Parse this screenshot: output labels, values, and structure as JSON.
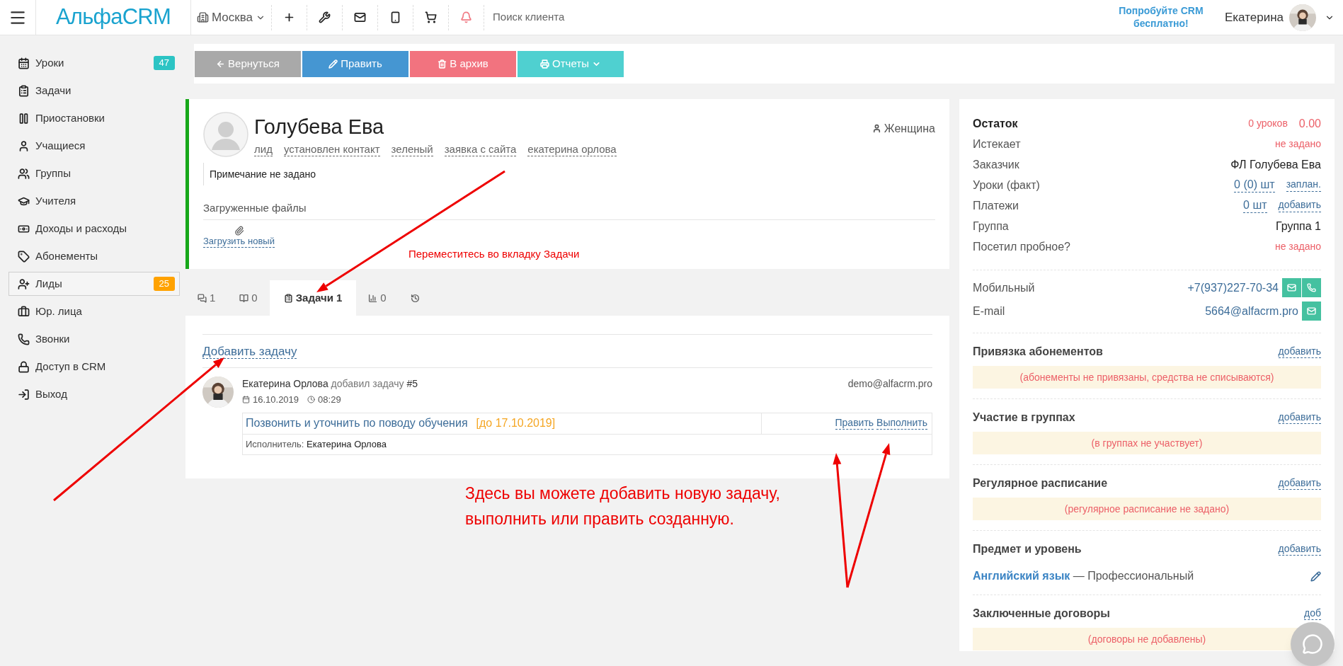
{
  "topbar": {
    "logo": "АльфаCRM",
    "city": "Москва",
    "search": {
      "placeholder": "Поиск клиента"
    },
    "promo": "Попробуйте CRM бесплатно!",
    "user": "Екатерина"
  },
  "sidebar": {
    "items": [
      {
        "label": "Уроки",
        "badge": "47",
        "color": "#2cc4c4",
        "selected": false
      },
      {
        "label": "Задачи",
        "selected": false
      },
      {
        "label": "Приостановки",
        "selected": false
      },
      {
        "label": "Учащиеся",
        "selected": false
      },
      {
        "label": "Группы",
        "selected": false
      },
      {
        "label": "Учителя",
        "selected": false
      },
      {
        "label": "Доходы и расходы",
        "selected": false
      },
      {
        "label": "Абонементы",
        "selected": false
      },
      {
        "label": "Лиды",
        "badge": "25",
        "color": "#ffa200",
        "selected": true
      },
      {
        "label": "Юр. лица",
        "selected": false
      },
      {
        "label": "Звонки",
        "selected": false
      },
      {
        "label": "Доступ в CRM",
        "selected": false
      },
      {
        "label": "Выход",
        "selected": false
      }
    ]
  },
  "actions": [
    {
      "kind": "back",
      "label": "Вернуться"
    },
    {
      "kind": "edit",
      "label": "Править"
    },
    {
      "kind": "archive",
      "label": "В архив"
    },
    {
      "kind": "reports",
      "label": "Отчеты"
    }
  ],
  "profile": {
    "name": "Голубева Ева",
    "gender": "Женщина",
    "tags": [
      "лид",
      "установлен контакт",
      "зеленый",
      "заявка с сайта",
      "екатерина орлова"
    ],
    "note": "Примечание не задано",
    "files_title": "Загруженные файлы",
    "upload": "Загрузить новый"
  },
  "tabs": [
    {
      "kind": "comments",
      "label": "1",
      "selected": false
    },
    {
      "kind": "book",
      "label": "0",
      "selected": false
    },
    {
      "kind": "tasks",
      "label": "Задачи 1",
      "selected": true
    },
    {
      "kind": "stats",
      "label": "0",
      "selected": false
    },
    {
      "kind": "history",
      "selected": false
    }
  ],
  "tasks": {
    "add": "Добавить задачу",
    "entries": [
      {
        "author": "Екатерина Орлова",
        "action": "добавил задачу",
        "number": "#5",
        "date": "16.10.2019",
        "time": "08:29",
        "email": "demo@alfacrm.pro",
        "title": "Позвонить и уточнить по поводу обучения",
        "deadline": "[до 17.10.2019]",
        "links": [
          "Править",
          "Выполнить"
        ],
        "executor_label": "Исполнитель:",
        "executor": "Екатерина Орлова"
      }
    ]
  },
  "annotations": [
    "Переместитесь во вкладку Задачи",
    "Здесь вы можете добавить новую задачу,\nвыполнить или править созданную."
  ],
  "summary": [
    {
      "label": "Остаток",
      "strong": true,
      "values": [
        {
          "kind": "red",
          "text": "0 уроков"
        },
        {
          "kind": "red_big",
          "text": "0.00"
        }
      ]
    },
    {
      "label": "Истекает",
      "strong": false,
      "values": [
        {
          "kind": "red",
          "text": "не задано"
        }
      ]
    },
    {
      "label": "Заказчик",
      "strong": false,
      "values": [
        {
          "kind": "plain",
          "text": "ФЛ Голубева Ева"
        }
      ]
    },
    {
      "label": "Уроки (факт)",
      "strong": false,
      "values": [
        {
          "kind": "link",
          "text": "0 (0) шт"
        },
        {
          "kind": "action",
          "text": "заплан."
        }
      ]
    },
    {
      "label": "Платежи",
      "strong": false,
      "values": [
        {
          "kind": "link",
          "text": "0 шт"
        },
        {
          "kind": "action",
          "text": "добавить"
        }
      ]
    },
    {
      "label": "Группа",
      "strong": false,
      "values": [
        {
          "kind": "plain",
          "text": "Группа 1"
        }
      ]
    },
    {
      "label": "Посетил пробное?",
      "strong": false,
      "values": [
        {
          "kind": "red",
          "text": "не задано"
        }
      ]
    }
  ],
  "contacts": [
    {
      "label": "Мобильный",
      "value": "+7(937)227-70-34",
      "call": true
    },
    {
      "label": "E-mail",
      "value": "5664@alfacrm.pro",
      "call": false
    }
  ],
  "sections": [
    {
      "kind": "empty",
      "title": "Привязка абонементов",
      "action": "добавить",
      "note": "(абонементы не привязаны, средства не списываются)"
    },
    {
      "kind": "empty",
      "title": "Участие в группах",
      "action": "добавить",
      "note": "(в группах не участвует)"
    },
    {
      "kind": "empty",
      "title": "Регулярное расписание",
      "action": "добавить",
      "note": "(регулярное расписание не задано)"
    },
    {
      "kind": "subject",
      "title": "Предмет и уровень",
      "action": "добавить",
      "subject": "Английский язык",
      "level": "— Профессиональный"
    },
    {
      "kind": "empty",
      "title": "Заключенные договоры",
      "action": "доб",
      "note": "(договоры не добавлены)"
    }
  ]
}
